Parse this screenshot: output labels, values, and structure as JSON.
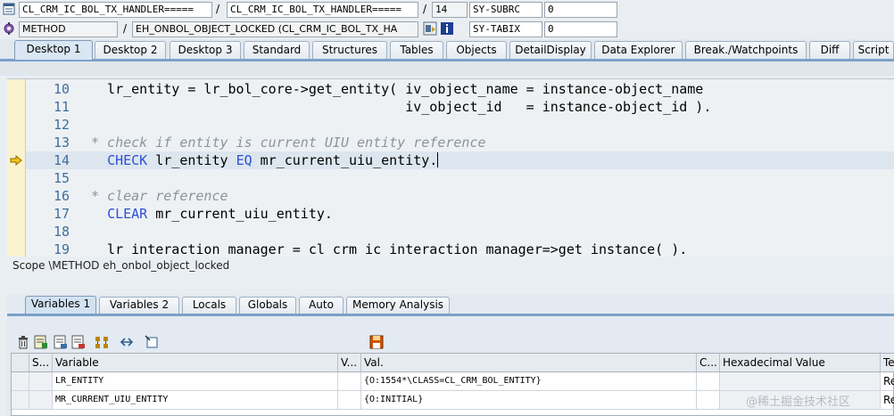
{
  "header": {
    "row1": {
      "program": "CL_CRM_IC_BOL_TX_HANDLER=====",
      "include": "CL_CRM_IC_BOL_TX_HANDLER=====",
      "line": "14",
      "sysvar_name": "SY-SUBRC",
      "sysvar_value": "0"
    },
    "row2": {
      "type": "METHOD",
      "event": "EH_ONBOL_OBJECT_LOCKED (CL_CRM_IC_BOL_TX_HA",
      "sysvar_name": "SY-TABIX",
      "sysvar_value": "0"
    },
    "separator": "/"
  },
  "main_tabs": [
    "Desktop 1",
    "Desktop 2",
    "Desktop 3",
    "Standard",
    "Structures",
    "Tables",
    "Objects",
    "DetailDisplay",
    "Data Explorer",
    "Break./Watchpoints",
    "Diff",
    "Script"
  ],
  "code": {
    "lines": [
      {
        "num": "10",
        "segments": [
          {
            "t": "  lr_entity = lr_bol_core->get_entity( iv_object_name = instance-object_name",
            "c": "plain"
          }
        ]
      },
      {
        "num": "11",
        "segments": [
          {
            "t": "                                       iv_object_id   = instance-object_id ).",
            "c": "plain"
          }
        ]
      },
      {
        "num": "12",
        "segments": []
      },
      {
        "num": "13",
        "segments": [
          {
            "t": "* check if entity is current UIU entity reference",
            "c": "cmt"
          }
        ]
      },
      {
        "num": "14",
        "segments": [
          {
            "t": "  ",
            "c": "plain"
          },
          {
            "t": "CHECK",
            "c": "kw"
          },
          {
            "t": " lr_entity ",
            "c": "plain"
          },
          {
            "t": "EQ",
            "c": "kw"
          },
          {
            "t": " mr_current_uiu_entity.",
            "c": "plain"
          }
        ]
      },
      {
        "num": "15",
        "segments": []
      },
      {
        "num": "16",
        "segments": [
          {
            "t": "* clear reference",
            "c": "cmt"
          }
        ]
      },
      {
        "num": "17",
        "segments": [
          {
            "t": "  ",
            "c": "plain"
          },
          {
            "t": "CLEAR",
            "c": "kw"
          },
          {
            "t": " mr_current_uiu_entity.",
            "c": "plain"
          }
        ]
      },
      {
        "num": "18",
        "segments": []
      },
      {
        "num": "19",
        "segments": [
          {
            "t": "  lr_interaction_manager = cl_crm_ic_interaction_manager=>get_instance( ).",
            "c": "plain"
          }
        ]
      }
    ],
    "current_line": "14"
  },
  "scope": "Scope \\METHOD eh_onbol_object_locked",
  "var_tabs": [
    "Variables 1",
    "Variables 2",
    "Locals",
    "Globals",
    "Auto",
    "Memory Analysis"
  ],
  "table": {
    "headers": [
      "S...",
      "Variable",
      "V...",
      "Val.",
      "C...",
      "Hexadecimal Value",
      "Te"
    ],
    "rows": [
      [
        "",
        "LR_ENTITY",
        "",
        "{O:1554*\\CLASS=CL_CRM_BOL_ENTITY}",
        "",
        "",
        "Re"
      ],
      [
        "",
        "MR_CURRENT_UIU_ENTITY",
        "",
        "{O:INITIAL}",
        "",
        "",
        "Re"
      ]
    ]
  },
  "watermark": "@稀土掘金技术社区",
  "colors": {
    "keyword": "#2b4fd6",
    "comment": "#8a949c",
    "line_number": "#3f6e9e",
    "gutter": "#fbf2cf",
    "tab_accent": "#7aa1c9"
  }
}
